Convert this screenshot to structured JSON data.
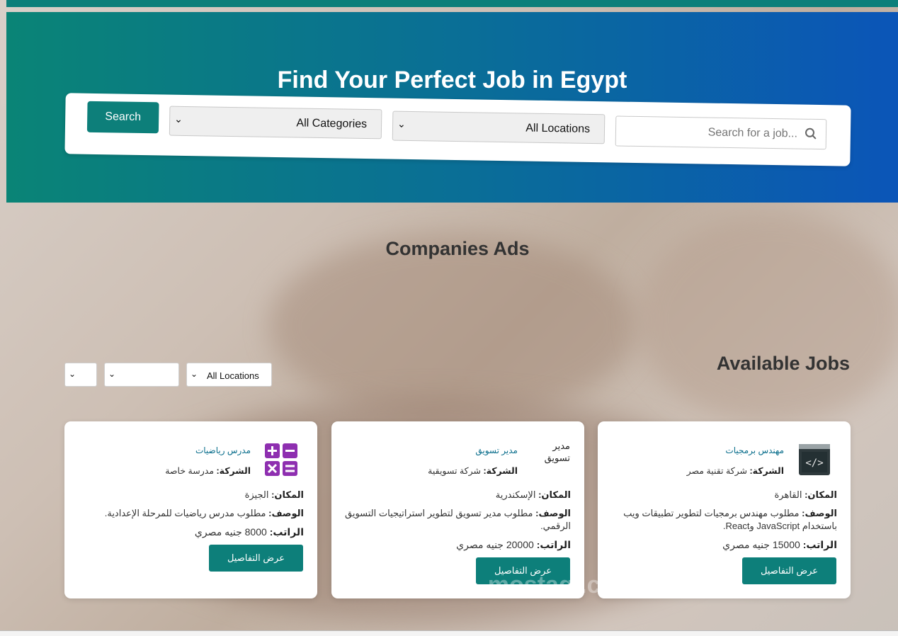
{
  "hero": {
    "title": "Find Your Perfect Job in Egypt",
    "search_button": "Search",
    "category_select": "All Categories",
    "location_select": "All Locations",
    "search_placeholder": "Search for a job..."
  },
  "companies_ads": {
    "title": "Companies Ads"
  },
  "available_jobs": {
    "title": "Available Jobs",
    "filters": {
      "location": "All Locations",
      "second": "",
      "third": ""
    }
  },
  "jobs": [
    {
      "title": "مهندس برمجيات",
      "company_label": "الشركة:",
      "company": "شركة تقنية مصر",
      "location_label": "المكان:",
      "location": "القاهرة",
      "description_label": "الوصف:",
      "description": "مطلوب مهندس برمجيات لتطوير تطبيقات ويب باستخدام JavaScript وReact.",
      "salary_label": "الراتب:",
      "salary_amount": "15000",
      "salary_currency": "جنيه مصري",
      "button": "عرض التفاصيل",
      "icon": "code-window-icon"
    },
    {
      "title": "مدير تسويق",
      "company_label": "الشركة:",
      "company": "شركة تسويقية",
      "location_label": "المكان:",
      "location": "الإسكندرية",
      "description_label": "الوصف:",
      "description": "مطلوب مدير تسويق لتطوير استراتيجيات التسويق الرقمي.",
      "salary_label": "الراتب:",
      "salary_amount": "20000",
      "salary_currency": "جنيه مصري",
      "button": "عرض التفاصيل",
      "image_alt": "مدير تسويق"
    },
    {
      "title": "مدرس رياضيات",
      "company_label": "الشركة:",
      "company": "مدرسة خاصة",
      "location_label": "المكان:",
      "location": "الجيزة",
      "description_label": "الوصف:",
      "description": "مطلوب مدرس رياضيات للمرحلة الإعدادية.",
      "salary_label": "الراتب:",
      "salary_amount": "8000",
      "salary_currency": "جنيه مصري",
      "button": "عرض التفاصيل",
      "icon": "calculator-icon"
    }
  ],
  "watermark": "مستقل mostaql.com",
  "colors": {
    "accent": "#0d7f7a",
    "hero_start": "#0a8476",
    "hero_end": "#0b55b8",
    "link": "#0a6e8c"
  }
}
